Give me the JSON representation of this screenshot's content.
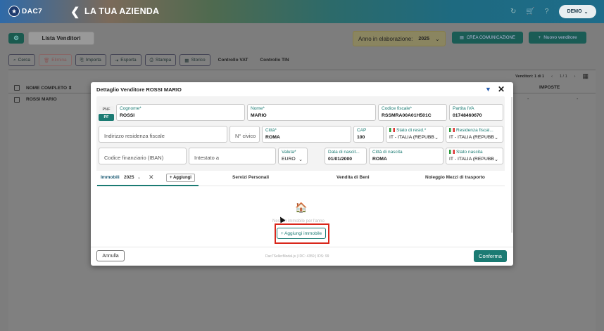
{
  "topbar": {
    "logo_text": "DAC7",
    "company": "LA TUA AZIENDA",
    "user_menu": "DEMO"
  },
  "page": {
    "lista_tab": "Lista Venditori",
    "anno_label": "Anno in elaborazione:",
    "anno_value": "2025",
    "crea_label": "CREA COMUNICAZIONE",
    "nuovo_label": "Nuovo venditore",
    "toolbar": {
      "cerca": "Cerca",
      "elimina": "Elimina",
      "importa": "Importa",
      "esporta": "Esporta",
      "stampa": "Stampa",
      "storico": "Storico",
      "controllo_vat": "Controllo VAT",
      "controllo_tin": "Controllo TIN"
    },
    "table": {
      "count": "Venditori: 1 di 1",
      "pager": "1 / 1",
      "headers": {
        "name": "NOME COMPLETO",
        "imposte": "IMPOSTE"
      },
      "rows": [
        {
          "name": "ROSSI MARIO",
          "col1": "-",
          "col2": "-"
        }
      ]
    }
  },
  "modal": {
    "title": "Dettaglio Venditore ROSSI MARIO",
    "pnf": "PNF",
    "pf": "PF",
    "fields": {
      "cognome": {
        "label": "Cognome*",
        "value": "ROSSI"
      },
      "nome": {
        "label": "Nome*",
        "value": "MARIO"
      },
      "codice_fiscale": {
        "label": "Codice fiscale*",
        "value": "RSSMRA00A01H501C"
      },
      "partita_iva": {
        "label": "Partita IVA",
        "value": "01748460670"
      },
      "indirizzo": {
        "placeholder": "Indirizzo residenza fiscale"
      },
      "civico": {
        "placeholder": "N° civico"
      },
      "citta": {
        "label": "Città*",
        "value": "ROMA"
      },
      "cap": {
        "label": "CAP",
        "value": "100"
      },
      "stato_resid": {
        "label": "Stato di resid.*",
        "value": "IT - ITALIA (REPUBB"
      },
      "residenza_fiscale": {
        "label": "Residenza fiscal...",
        "value": "IT - ITALIA (REPUBB"
      },
      "iban": {
        "placeholder": "Codice finanziario (IBAN)"
      },
      "intestato": {
        "placeholder": "Intestato a"
      },
      "valuta": {
        "label": "Valuta*",
        "value": "EURO"
      },
      "data_nascita": {
        "label": "Data di nascit...",
        "value": "01/01/2000"
      },
      "citta_nascita": {
        "label": "Città di nascita",
        "value": "ROMA"
      },
      "stato_nascita": {
        "label": "Stato nascita",
        "value": "IT - ITALIA (REPUBB"
      }
    },
    "tabs": {
      "immobili": "Immobili",
      "year": "2025",
      "aggiungi": "+ Aggiungi",
      "servizi": "Servizi Personali",
      "vendita": "Vendita di Beni",
      "noleggio": "Noleggio Mezzi di trasporto"
    },
    "empty_text": "Nessun immobile per l'anno",
    "aggiungi_immobile": "+ Aggiungi immobile",
    "annulla": "Annulla",
    "footer_info": "Dac7SellerModal.js | IDC: 4359 | IDS: 99",
    "conferma": "Conferma"
  }
}
